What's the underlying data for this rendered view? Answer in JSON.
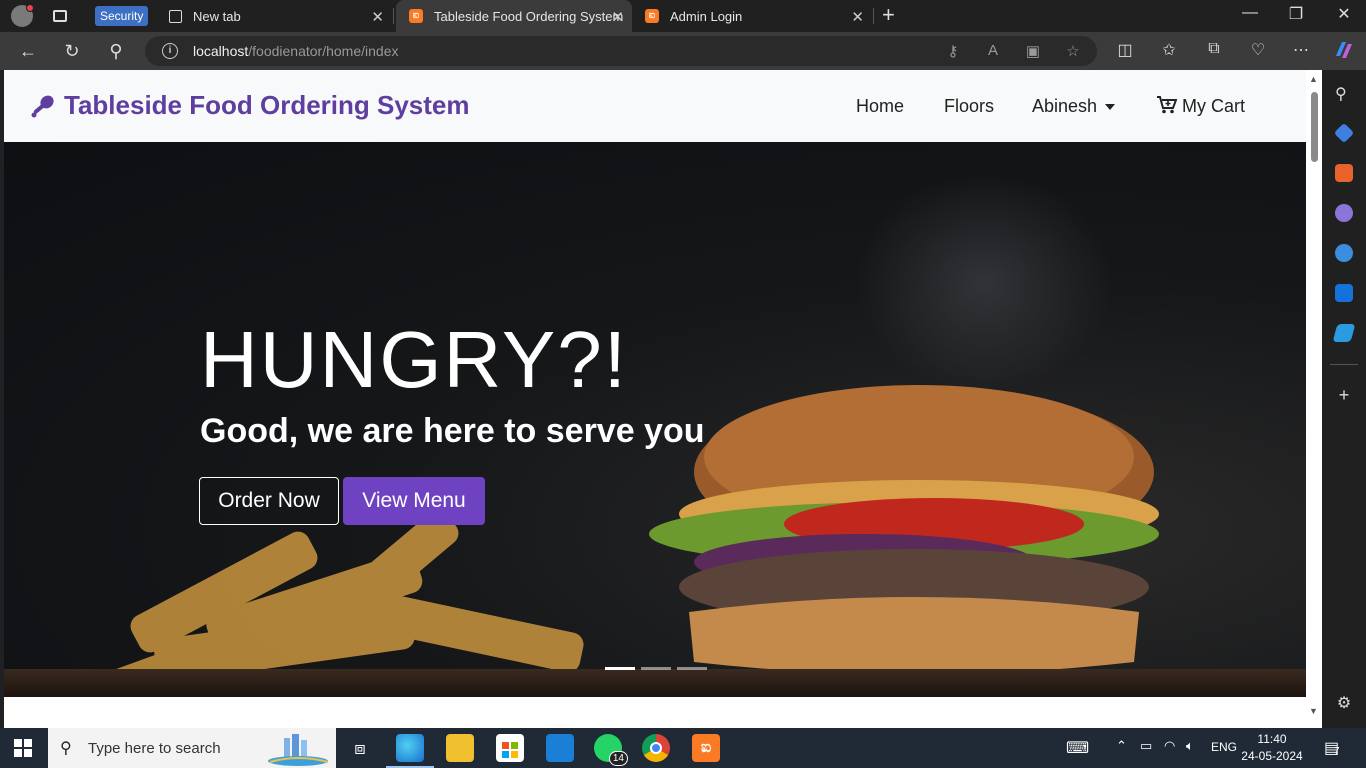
{
  "browser": {
    "security_badge": "Security",
    "tabs": [
      {
        "title": "New tab"
      },
      {
        "title": "Tableside Food Ordering System"
      },
      {
        "title": "Admin Login"
      }
    ],
    "url_host": "localhost",
    "url_path": "/foodienator/home/index"
  },
  "site": {
    "brand": "Tableside Food Ordering System",
    "brand_color": "#5e3e9e",
    "nav": {
      "home": "Home",
      "floors": "Floors",
      "user": "Abinesh",
      "cart": "My Cart"
    }
  },
  "hero": {
    "title": "HUNGRY?!",
    "subtitle": "Good, we are here to serve you",
    "order_button": "Order Now",
    "menu_button": "View Menu",
    "accent": "#6f42c1",
    "slides": 3,
    "active_slide": 1
  },
  "taskbar": {
    "search_placeholder": "Type here to search",
    "whatsapp_badge": "14",
    "language": "ENG",
    "time": "11:40",
    "date": "24-05-2024",
    "notifications": "7"
  }
}
